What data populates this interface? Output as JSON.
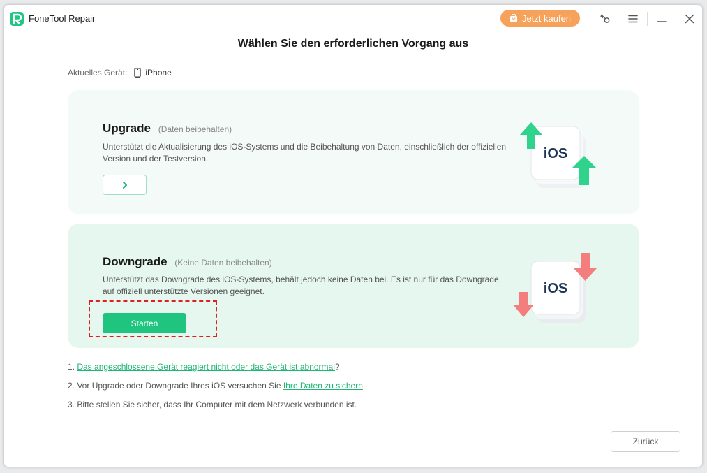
{
  "titlebar": {
    "app_name": "FoneTool Repair",
    "buy_label": "Jetzt kaufen",
    "buy_color": "#f6a25b",
    "icons": [
      "key-icon",
      "menu-icon",
      "minimize-icon",
      "close-icon"
    ]
  },
  "page_title": "Wählen Sie den erforderlichen Vorgang aus",
  "device": {
    "label": "Aktuelles Gerät:",
    "name": "iPhone",
    "icon": "phone-icon"
  },
  "upgrade": {
    "title": "Upgrade",
    "hint": "(Daten beibehalten)",
    "description": "Unterstützt die Aktualisierung des iOS-Systems und die Beibehaltung von Daten, einschließlich der offiziellen Version und der Testversion.",
    "button_icon": "chevron-right-icon",
    "graphic_label": "iOS",
    "arrow_color": "#2fd38b"
  },
  "downgrade": {
    "title": "Downgrade",
    "hint": "(Keine Daten beibehalten)",
    "description": "Unterstützt das Downgrade des iOS-Systems, behält jedoch keine Daten bei. Es ist nur für das Downgrade auf offiziell unterstützte Versionen geeignet.",
    "button_label": "Starten",
    "graphic_label": "iOS",
    "arrow_color": "#f47d7d"
  },
  "notes": {
    "n1_prefix": "1. ",
    "n1_link": "Das angeschlossene Gerät reagiert nicht oder das Gerät ist abnormal",
    "n1_suffix": "?",
    "n2_prefix": "2. Vor Upgrade oder Downgrade Ihres iOS versuchen Sie ",
    "n2_link": "Ihre Daten zu sichern",
    "n2_suffix": ".",
    "n3": "3. Bitte stellen Sie sicher, dass Ihr Computer mit dem Netzwerk verbunden ist."
  },
  "back_label": "Zurück",
  "accent_color": "#1fc47e"
}
